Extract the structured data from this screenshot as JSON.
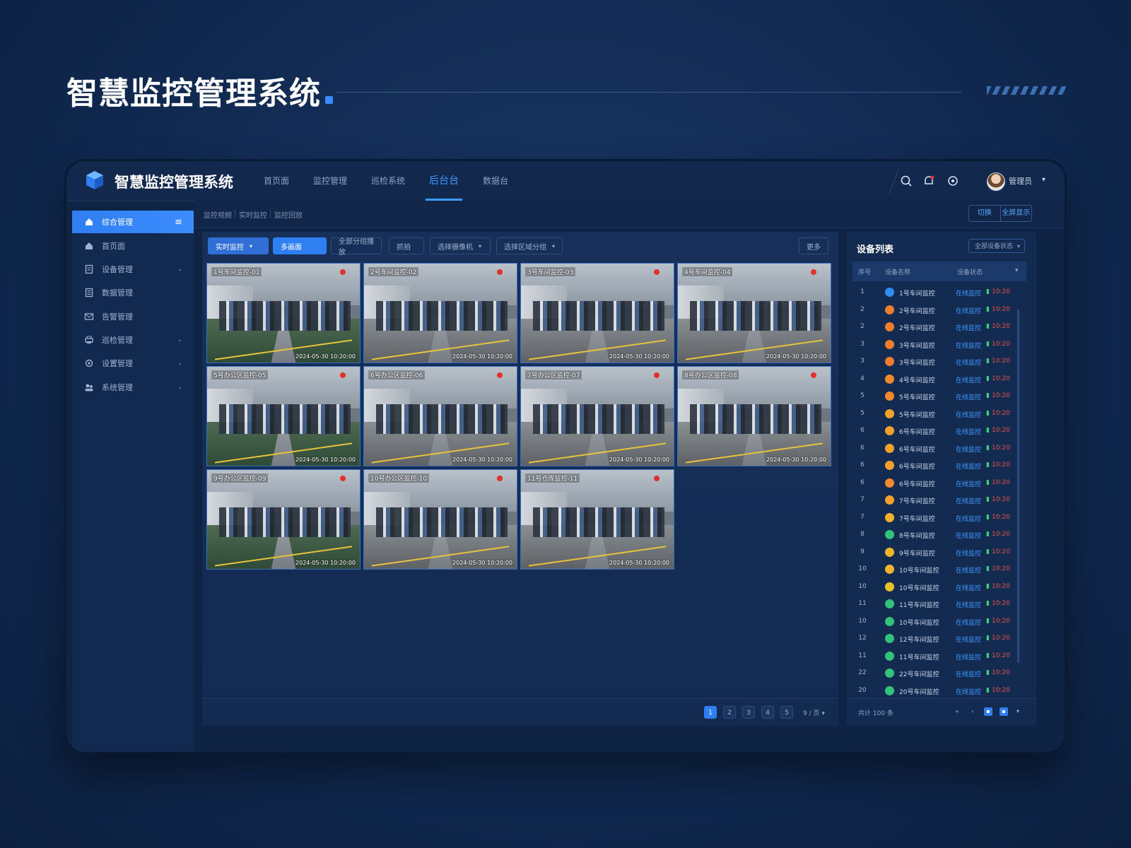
{
  "hero_title": "智慧监控管理系统",
  "app": {
    "title": "智慧监控管理系统",
    "nav": [
      {
        "label": "首页面",
        "active": false
      },
      {
        "label": "监控管理",
        "active": false
      },
      {
        "label": "巡检系统",
        "active": false
      },
      {
        "label": "后台台",
        "active": true
      },
      {
        "label": "数据台",
        "active": false
      }
    ],
    "user": {
      "name": "管理员"
    }
  },
  "sidebar": {
    "items": [
      {
        "label": "综合管理",
        "icon": "home-icon",
        "active": true,
        "expandable": false
      },
      {
        "label": "首页面",
        "icon": "home-icon",
        "active": false,
        "expandable": false
      },
      {
        "label": "设备管理",
        "icon": "document-icon",
        "active": false,
        "expandable": true
      },
      {
        "label": "数据管理",
        "icon": "list-icon",
        "active": false,
        "expandable": false
      },
      {
        "label": "告警管理",
        "icon": "mail-icon",
        "active": false,
        "expandable": false
      },
      {
        "label": "巡检管理",
        "icon": "printer-icon",
        "active": false,
        "expandable": true
      },
      {
        "label": "设置管理",
        "icon": "gear-icon",
        "active": false,
        "expandable": true
      },
      {
        "label": "系统管理",
        "icon": "users-icon",
        "active": false,
        "expandable": true
      }
    ]
  },
  "breadcrumbs": [
    "监控视频",
    "实时监控",
    "监控回放"
  ],
  "top_actions": [
    "切换",
    "全屏显示"
  ],
  "toolbar": {
    "buttons": [
      {
        "label": "实时监控",
        "style": "blue",
        "dropdown": true
      },
      {
        "label": "多画面",
        "style": "primary",
        "dropdown": false
      },
      {
        "label": "全部分组播放",
        "style": "default",
        "dropdown": false
      },
      {
        "label": "抓拍",
        "style": "default",
        "dropdown": false
      },
      {
        "label": "选择摄像机",
        "style": "default",
        "dropdown": true
      },
      {
        "label": "选择区域分组",
        "style": "default",
        "dropdown": true
      }
    ],
    "right_button": "更多"
  },
  "cameras": [
    {
      "label": "1号车间监控-01",
      "timestamp": "2024-05-30 10:20:00",
      "floor": "green"
    },
    {
      "label": "2号车间监控-02",
      "timestamp": "2024-05-30 10:20:00",
      "floor": "grey"
    },
    {
      "label": "3号车间监控-03",
      "timestamp": "2024-05-30 10:20:00",
      "floor": "grey"
    },
    {
      "label": "4号车间监控-04",
      "timestamp": "2024-05-30 10:20:00",
      "floor": "grey"
    },
    {
      "label": "5号办公区监控-05",
      "timestamp": "2024-05-30 10:20:00",
      "floor": "green"
    },
    {
      "label": "6号办公区监控-06",
      "timestamp": "2024-05-30 10:20:00",
      "floor": "grey"
    },
    {
      "label": "7号办公区监控-07",
      "timestamp": "2024-05-30 10:20:00",
      "floor": "grey"
    },
    {
      "label": "8号办公区监控-08",
      "timestamp": "2024-05-30 10:20:00",
      "floor": "grey"
    },
    {
      "label": "9号办公区监控-09",
      "timestamp": "2024-05-30 10:20:00",
      "floor": "green"
    },
    {
      "label": "10号办公区监控-10",
      "timestamp": "2024-05-30 10:20:00",
      "floor": "grey"
    },
    {
      "label": "11号仓库监控-11",
      "timestamp": "2024-05-30 10:20:00",
      "floor": "grey"
    }
  ],
  "pager": {
    "pages": [
      "1",
      "2",
      "3",
      "4",
      "5"
    ],
    "active": 1,
    "per_page": "9 / 页"
  },
  "panel": {
    "title": "设备列表",
    "select_label": "全部设备状态",
    "columns": [
      "序号",
      "设备名称",
      "设备状态"
    ],
    "rows": [
      {
        "idx": "1",
        "color": "#2f8df2",
        "name": "1号车间监控",
        "status": "在线监控",
        "time": "10:20"
      },
      {
        "idx": "2",
        "color": "#ef7d2e",
        "name": "2号车间监控",
        "status": "在线监控",
        "time": "10:20"
      },
      {
        "idx": "2",
        "color": "#ef7d2e",
        "name": "2号车间监控",
        "status": "在线监控",
        "time": "10:20"
      },
      {
        "idx": "3",
        "color": "#ef7d2e",
        "name": "3号车间监控",
        "status": "在线监控",
        "time": "10:20"
      },
      {
        "idx": "3",
        "color": "#ef7d2e",
        "name": "3号车间监控",
        "status": "在线监控",
        "time": "10:20"
      },
      {
        "idx": "4",
        "color": "#f08a2c",
        "name": "4号车间监控",
        "status": "在线监控",
        "time": "10:20"
      },
      {
        "idx": "5",
        "color": "#f08a2c",
        "name": "5号车间监控",
        "status": "在线监控",
        "time": "10:20"
      },
      {
        "idx": "5",
        "color": "#f3a12b",
        "name": "5号车间监控",
        "status": "在线监控",
        "time": "10:20"
      },
      {
        "idx": "6",
        "color": "#f3a12b",
        "name": "6号车间监控",
        "status": "在线监控",
        "time": "10:20"
      },
      {
        "idx": "6",
        "color": "#f3a12b",
        "name": "6号车间监控",
        "status": "在线监控",
        "time": "10:20"
      },
      {
        "idx": "6",
        "color": "#f3a12b",
        "name": "6号车间监控",
        "status": "在线监控",
        "time": "10:20"
      },
      {
        "idx": "6",
        "color": "#f08a2c",
        "name": "6号车间监控",
        "status": "在线监控",
        "time": "10:20"
      },
      {
        "idx": "7",
        "color": "#f3a12b",
        "name": "7号车间监控",
        "status": "在线监控",
        "time": "10:20"
      },
      {
        "idx": "7",
        "color": "#f3b32b",
        "name": "7号车间监控",
        "status": "在线监控",
        "time": "10:20"
      },
      {
        "idx": "8",
        "color": "#32c27a",
        "name": "8号车间监控",
        "status": "在线监控",
        "time": "10:20"
      },
      {
        "idx": "9",
        "color": "#f3b32b",
        "name": "9号车间监控",
        "status": "在线监控",
        "time": "10:20"
      },
      {
        "idx": "10",
        "color": "#f3b32b",
        "name": "10号车间监控",
        "status": "在线监控",
        "time": "10:20"
      },
      {
        "idx": "10",
        "color": "#e8c12b",
        "name": "10号车间监控",
        "status": "在线监控",
        "time": "10:20"
      },
      {
        "idx": "11",
        "color": "#32c27a",
        "name": "11号车间监控",
        "status": "在线监控",
        "time": "10:20"
      },
      {
        "idx": "10",
        "color": "#32c27a",
        "name": "10号车间监控",
        "status": "在线监控",
        "time": "10:20"
      },
      {
        "idx": "12",
        "color": "#32c27a",
        "name": "12号车间监控",
        "status": "在线监控",
        "time": "10:20"
      },
      {
        "idx": "11",
        "color": "#32c27a",
        "name": "11号车间监控",
        "status": "在线监控",
        "time": "10:20"
      },
      {
        "idx": "22",
        "color": "#32c27a",
        "name": "22号车间监控",
        "status": "在线监控",
        "time": "10:20"
      },
      {
        "idx": "20",
        "color": "#32c27a",
        "name": "20号车间监控",
        "status": "在线监控",
        "time": "10:20"
      }
    ],
    "footer_text": "共计 100 条"
  },
  "colors": {
    "accent": "#2f7ff2",
    "background": "#112a52",
    "panel": "#142b51",
    "rec": "#e0322b"
  }
}
